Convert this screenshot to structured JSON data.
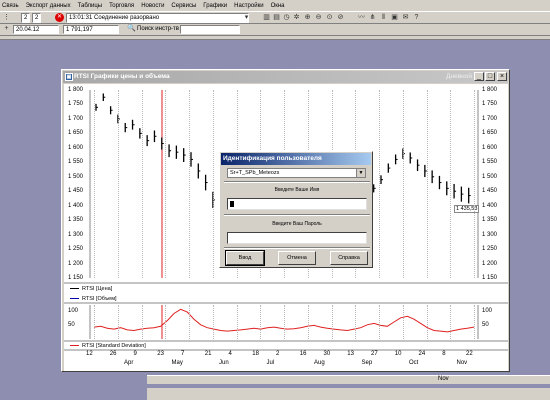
{
  "menu": {
    "items": [
      "Связь",
      "Экспорт данных",
      "Таблицы",
      "Торговля",
      "Новости",
      "Сервисы",
      "Графики",
      "Настройки",
      "Окна"
    ]
  },
  "toolbar": {
    "counter_left": "2",
    "counter_right": "2",
    "status_text": "13:01:31 Соединение разорвано",
    "date_value": "20.04.12",
    "price_value": "1 791,197",
    "search_label": "Поиск инстр-тв"
  },
  "chart_window": {
    "title": "RTSI Графики цены и объема",
    "title_right": "Дневной",
    "price_axis": [
      "1 800",
      "1 750",
      "1 700",
      "1 650",
      "1 600",
      "1 550",
      "1 500",
      "1 450",
      "1 400",
      "1 350",
      "1 300",
      "1 250",
      "1 200",
      "1 150"
    ],
    "last_price_tag": "1 435,53",
    "legend_price": "RTSI [Цена]",
    "legend_volume": "RTSI [Объем]",
    "legend_sd": "RTSI [Standard Deviation]",
    "sd_axis": [
      "100",
      "50"
    ],
    "x_days": [
      "12",
      "26",
      "9",
      "23",
      "7",
      "21",
      "4",
      "18",
      "2",
      "16",
      "30",
      "13",
      "27",
      "10",
      "24",
      "8",
      "22"
    ],
    "x_months": [
      "Apr",
      "May",
      "Jun",
      "Jul",
      "Aug",
      "Sep",
      "Oct",
      "Nov"
    ]
  },
  "scroll": {
    "month_label": "Nov"
  },
  "dialog": {
    "title": "Идентификация пользователя",
    "account_value": "Sr+T_SPb_Meteozs",
    "name_label": "Введите Ваше Имя",
    "name_value": "",
    "password_label": "Введите Ваш Пароль",
    "password_value": "",
    "btn_ok": "Ввод",
    "btn_cancel": "Отмена",
    "btn_help": "Справка"
  },
  "colors": {
    "price_bars": "#000000",
    "sd_line": "#e02020",
    "marker_line": "#e02020"
  },
  "chart_data": [
    {
      "type": "bar",
      "title": "",
      "series": [
        {
          "name": "RTSI [Цена]",
          "values": [
            1740,
            1775,
            1730,
            1700,
            1670,
            1680,
            1650,
            1625,
            1640,
            1615,
            1590,
            1585,
            1575,
            1560,
            1520,
            1480,
            1420,
            1360,
            1320,
            1290,
            1270,
            1250,
            1260,
            1285,
            1300,
            1330,
            1345,
            1340,
            1355,
            1380,
            1400,
            1360,
            1340,
            1350,
            1370,
            1380,
            1395,
            1420,
            1460,
            1490,
            1530,
            1560,
            1580,
            1565,
            1540,
            1520,
            1500,
            1480,
            1460,
            1450,
            1440,
            1435
          ]
        }
      ],
      "ylim": [
        1150,
        1800
      ],
      "ylabel": ""
    },
    {
      "type": "line",
      "title": "",
      "series": [
        {
          "name": "RTSI [Standard Deviation]",
          "values": [
            42,
            45,
            38,
            35,
            40,
            32,
            30,
            35,
            38,
            40,
            45,
            65,
            90,
            105,
            95,
            70,
            50,
            40,
            35,
            30,
            28,
            30,
            32,
            35,
            38,
            35,
            40,
            42,
            38,
            35,
            36,
            40,
            45,
            48,
            42,
            38,
            35,
            32,
            30,
            35,
            40,
            50,
            55,
            48,
            45,
            60,
            75,
            80,
            70,
            55,
            40,
            30,
            28,
            25,
            30,
            35,
            38,
            42
          ]
        }
      ],
      "ylim": [
        0,
        120
      ]
    }
  ]
}
